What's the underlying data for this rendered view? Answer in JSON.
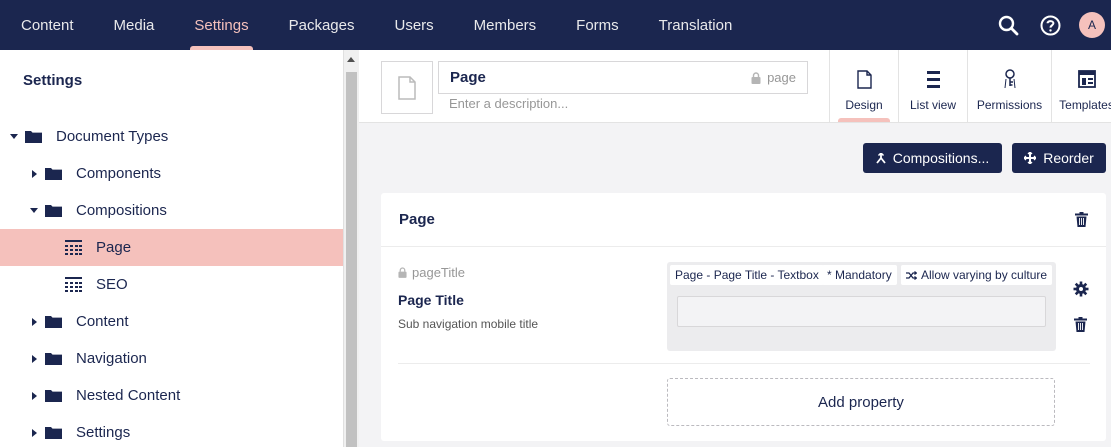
{
  "topnav": {
    "items": [
      {
        "label": "Content",
        "active": false
      },
      {
        "label": "Media",
        "active": false
      },
      {
        "label": "Settings",
        "active": true
      },
      {
        "label": "Packages",
        "active": false
      },
      {
        "label": "Users",
        "active": false
      },
      {
        "label": "Members",
        "active": false
      },
      {
        "label": "Forms",
        "active": false
      },
      {
        "label": "Translation",
        "active": false
      }
    ],
    "avatar_initial": "A",
    "icons": [
      "search-icon",
      "help-icon"
    ]
  },
  "sidebar": {
    "title": "Settings",
    "tree": [
      {
        "label": "Document Types",
        "caret": "down",
        "icon": "folder-icon",
        "level": 0
      },
      {
        "label": "Components",
        "caret": "right",
        "icon": "folder-icon",
        "level": 1
      },
      {
        "label": "Compositions",
        "caret": "down",
        "icon": "folder-icon",
        "level": 1
      },
      {
        "label": "Page",
        "caret": "none",
        "icon": "document-type-icon",
        "level": 2,
        "selected": true
      },
      {
        "label": "SEO",
        "caret": "none",
        "icon": "document-type-icon",
        "level": 2
      },
      {
        "label": "Content",
        "caret": "right",
        "icon": "folder-icon",
        "level": 1
      },
      {
        "label": "Navigation",
        "caret": "right",
        "icon": "folder-icon",
        "level": 1
      },
      {
        "label": "Nested Content",
        "caret": "right",
        "icon": "folder-icon",
        "level": 1
      },
      {
        "label": "Settings",
        "caret": "right",
        "icon": "folder-icon",
        "level": 1
      }
    ]
  },
  "editor": {
    "name": "Page",
    "alias": "page",
    "description_placeholder": "Enter a description...",
    "tabs": [
      {
        "label": "Design",
        "icon": "document-icon",
        "active": true
      },
      {
        "label": "List view",
        "icon": "list-icon",
        "active": false
      },
      {
        "label": "Permissions",
        "icon": "key-icon",
        "active": false
      },
      {
        "label": "Templates",
        "icon": "layout-icon",
        "active": false
      }
    ],
    "buttons": {
      "compositions": "Compositions...",
      "reorder": "Reorder"
    },
    "group": {
      "title": "Page",
      "property": {
        "alias": "pageTitle",
        "name": "Page Title",
        "description": "Sub navigation mobile title",
        "tags": [
          "Page - Page Title - Textbox",
          "* Mandatory",
          "Allow varying by culture"
        ]
      },
      "add_property": "Add property"
    }
  },
  "colors": {
    "navy": "#1b264f",
    "pink": "#f5c1bc",
    "background": "#f3f3f5"
  }
}
